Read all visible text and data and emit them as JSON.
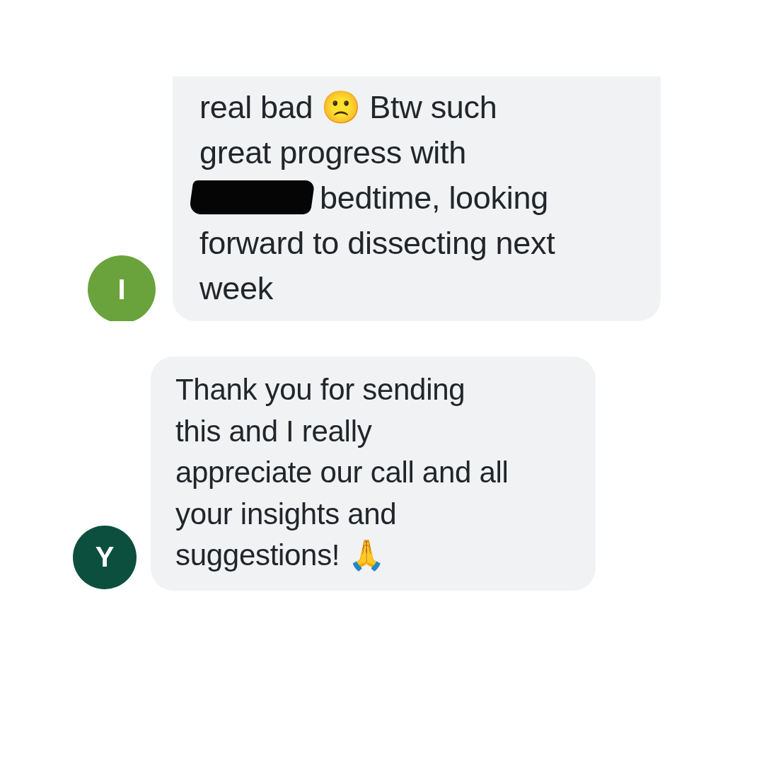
{
  "messages": [
    {
      "avatar": {
        "initial": "I",
        "color": "#6aa33c"
      },
      "text_before": "real bad 🙁 Btw such\ngreat progress with\n",
      "redacted": true,
      "text_after": "bedtime, looking\nforward to dissecting next\nweek",
      "cut_top": true
    },
    {
      "avatar": {
        "initial": "Y",
        "color": "#0d4f3f"
      },
      "text_before": "Thank you for sending\nthis and I really\nappreciate our call and all\nyour insights and\nsuggestions! 🙏"
    }
  ]
}
